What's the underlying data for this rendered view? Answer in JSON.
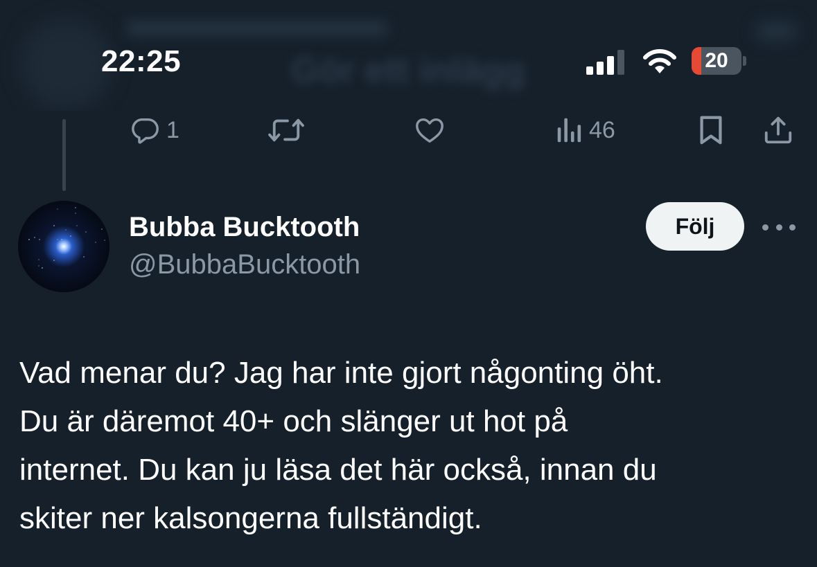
{
  "header": {
    "blurred_title": "Gör ett inlägg"
  },
  "status_bar": {
    "time": "22:25",
    "battery_level": "20",
    "battery_fraction": 0.2,
    "battery_color": "#e64a35"
  },
  "actions": {
    "reply_count": "1",
    "views_count": "46"
  },
  "author": {
    "display_name": "Bubba Bucktooth",
    "handle": "@BubbaBucktooth",
    "follow_label": "Följ"
  },
  "tweet": {
    "lines": [
      "Vad menar du? Jag har inte gjort någonting öht.",
      "Du är däremot 40+ och slänger ut hot på",
      "internet.  Du kan ju läsa det här också, innan du",
      "skiter ner kalsongerna fullständigt."
    ]
  },
  "colors": {
    "background": "#15202b",
    "secondary_text": "#8b98a5",
    "follow_button_bg": "#eff3f4"
  },
  "icons": [
    "reply-icon",
    "retweet-icon",
    "like-icon",
    "views-icon",
    "bookmark-icon",
    "share-icon",
    "more-icon",
    "signal-icon",
    "wifi-icon",
    "battery-icon"
  ]
}
